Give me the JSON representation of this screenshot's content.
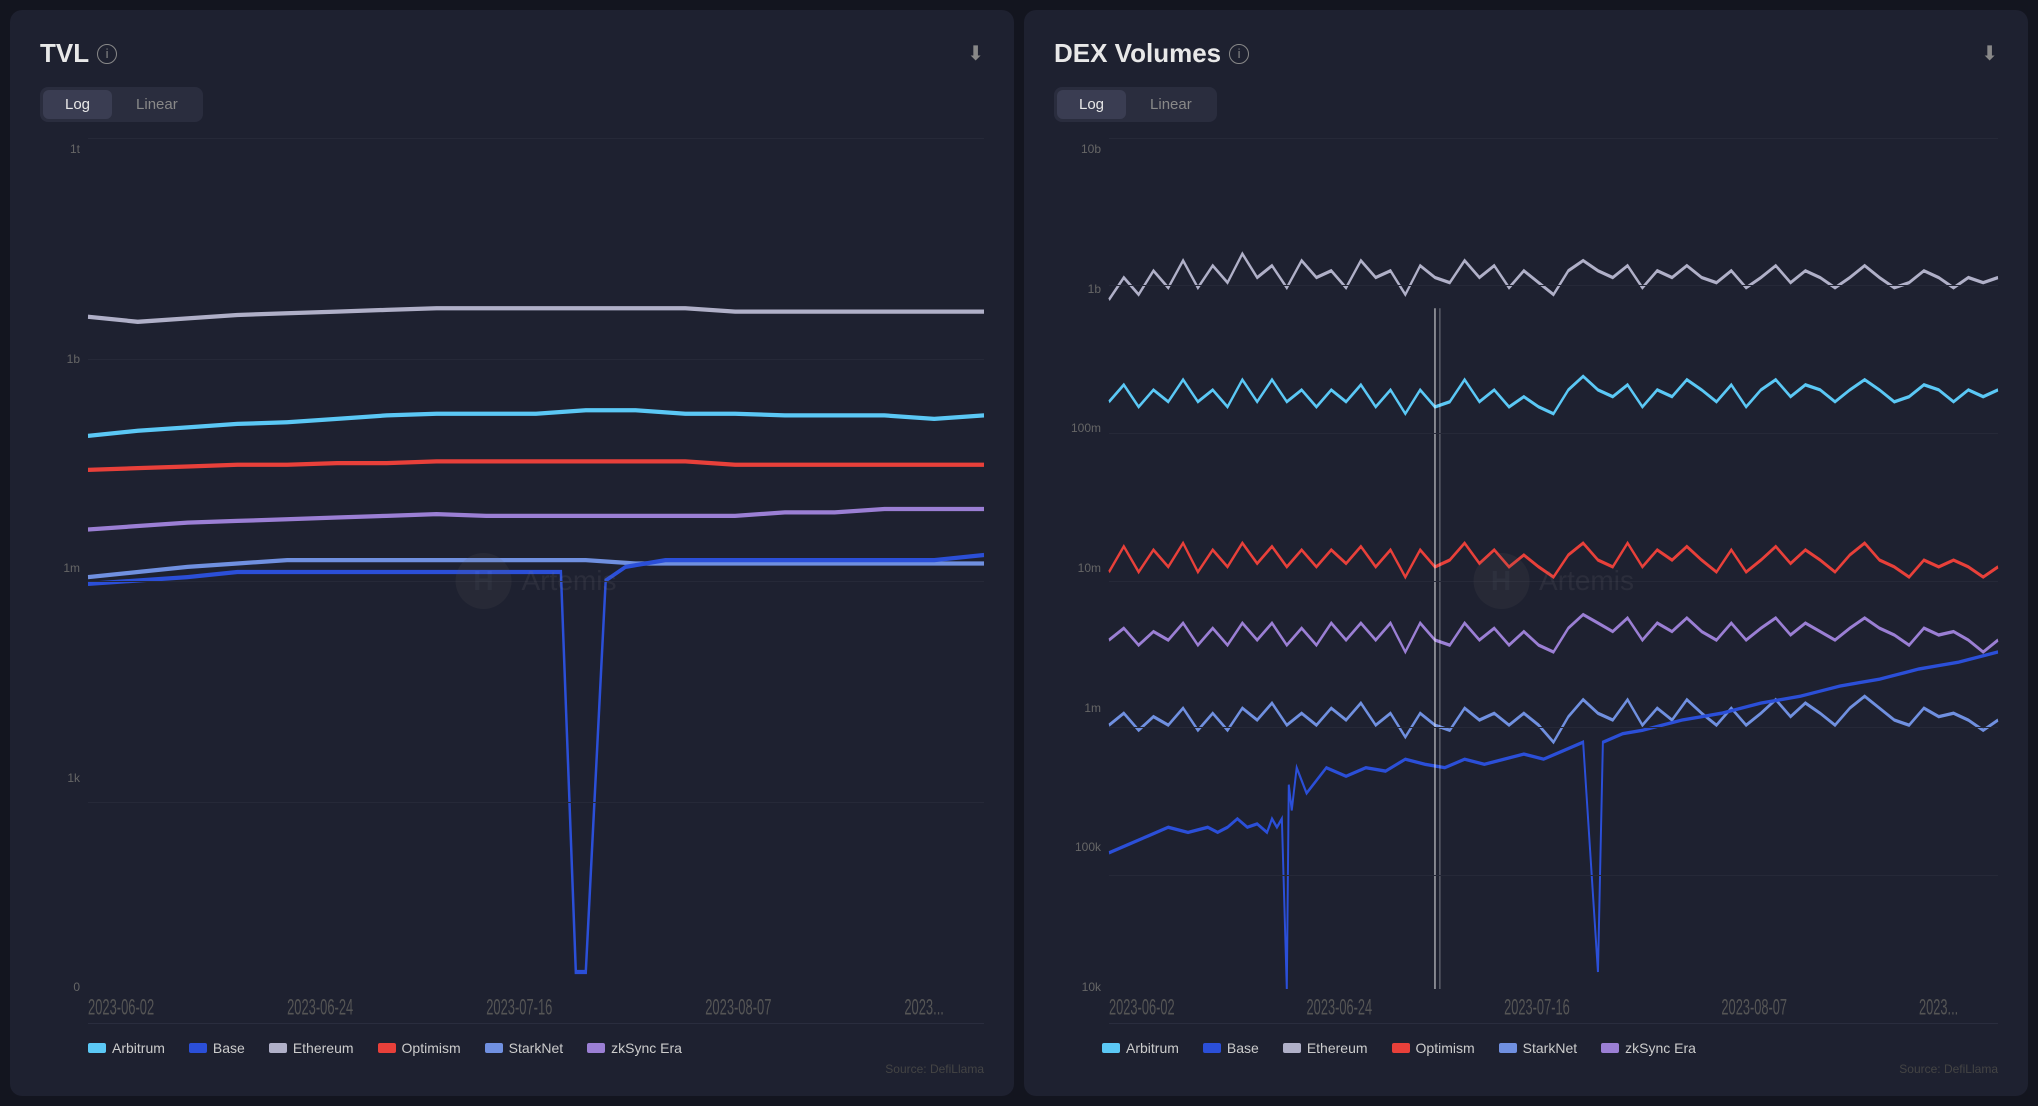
{
  "tvl": {
    "title": "TVL",
    "download_icon": "⬇",
    "toggle": {
      "log_label": "Log",
      "linear_label": "Linear",
      "active": "log"
    },
    "y_axis": [
      "1t",
      "1b",
      "1m",
      "1k",
      "0"
    ],
    "x_axis": [
      "2023-06-02",
      "2023-06-24",
      "2023-07-16",
      "2023-08-07",
      "2023..."
    ],
    "source": "Source: DefiLlama"
  },
  "dex": {
    "title": "DEX Volumes",
    "download_icon": "⬇",
    "toggle": {
      "log_label": "Log",
      "linear_label": "Linear",
      "active": "log"
    },
    "y_axis": [
      "10b",
      "1b",
      "100m",
      "10m",
      "1m",
      "100k",
      "10k"
    ],
    "x_axis": [
      "2023-06-02",
      "2023-06-24",
      "2023-07-16",
      "2023-08-07",
      "2023..."
    ],
    "source": "Source: DefiLlama"
  },
  "legend": {
    "items": [
      {
        "name": "Arbitrum",
        "color": "#5bc8f5"
      },
      {
        "name": "Base",
        "color": "#2b4fd8"
      },
      {
        "name": "Ethereum",
        "color": "#b0b0c8"
      },
      {
        "name": "Optimism",
        "color": "#e8403a"
      },
      {
        "name": "StarkNet",
        "color": "#7090e0"
      },
      {
        "name": "zkSync Era",
        "color": "#9b7fd4"
      }
    ]
  }
}
